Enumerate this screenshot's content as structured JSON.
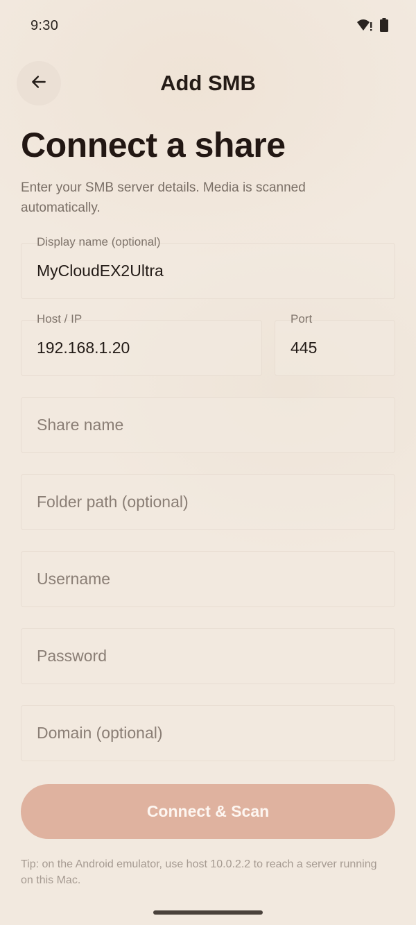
{
  "status_bar": {
    "time": "9:30",
    "icons": [
      "wifi-alert-icon",
      "battery-icon"
    ]
  },
  "app_bar": {
    "title": "Add SMB",
    "back_icon": "arrow-left-icon"
  },
  "header": {
    "title": "Connect a share",
    "subtitle": "Enter your SMB server details. Media is scanned automatically."
  },
  "form": {
    "display_name": {
      "label": "Display name (optional)",
      "value": "MyCloudEX2Ultra"
    },
    "host": {
      "label": "Host / IP",
      "value": "192.168.1.20"
    },
    "port": {
      "label": "Port",
      "value": "445"
    },
    "share_name": {
      "placeholder": "Share name"
    },
    "folder_path": {
      "placeholder": "Folder path (optional)"
    },
    "username": {
      "placeholder": "Username"
    },
    "password": {
      "placeholder": "Password"
    },
    "domain": {
      "placeholder": "Domain (optional)"
    }
  },
  "actions": {
    "connect_label": "Connect & Scan"
  },
  "tip": "Tip: on the Android emulator, use host 10.0.2.2 to reach a server running on this Mac.",
  "colors": {
    "background": "#f2e9df",
    "button": "#dfb29f",
    "text_primary": "#221a16",
    "text_secondary": "#7a6f66"
  }
}
